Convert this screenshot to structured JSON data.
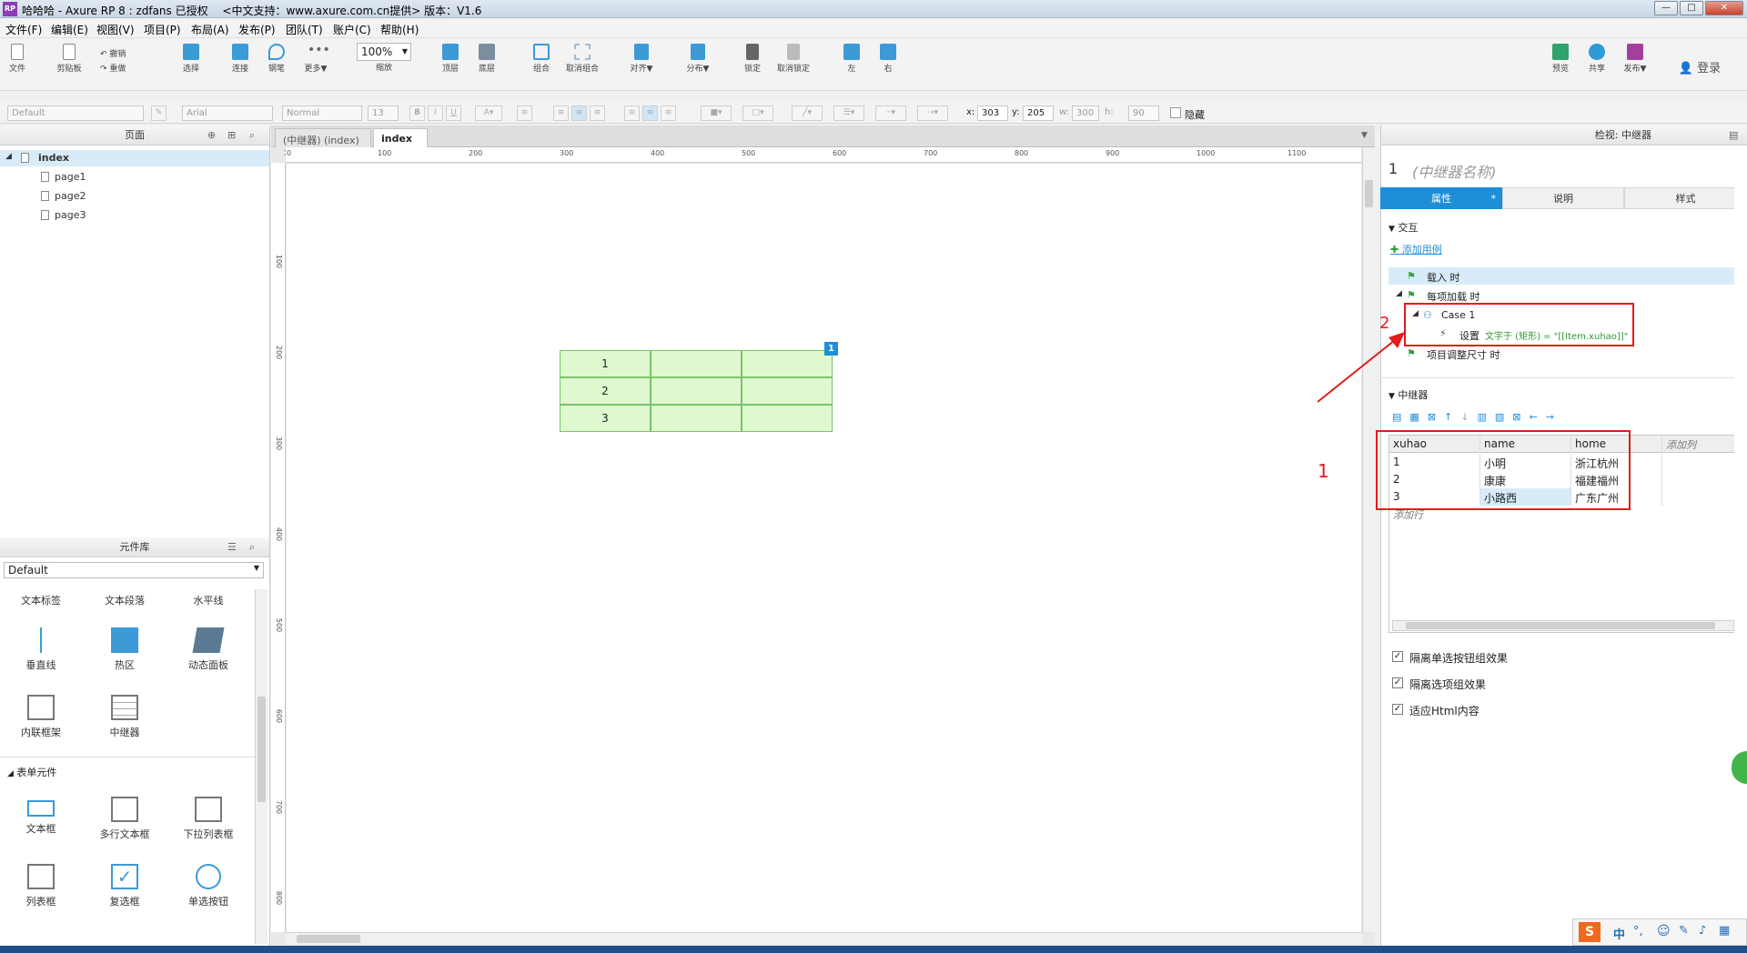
{
  "window": {
    "title": "哈哈哈 - Axure RP 8 : zdfans 已授权　 <中文支持：www.axure.com.cn提供> 版本：V1.6",
    "logo": "RP",
    "min": "—",
    "max": "□",
    "close": "✕"
  },
  "menu": [
    "文件(F)",
    "编辑(E)",
    "视图(V)",
    "项目(P)",
    "布局(A)",
    "发布(P)",
    "团队(T)",
    "账户(C)",
    "帮助(H)"
  ],
  "toolbar": {
    "file": "文件",
    "clipboard": "剪贴板",
    "undo": "撤销",
    "redo": "重做",
    "select": "选择",
    "connect": "连接",
    "pen": "钢笔",
    "more": "更多▼",
    "zoom_value": "100%",
    "zoom_label": "缩放",
    "top": "顶层",
    "bottom": "底层",
    "group": "组合",
    "ungroup": "取消组合",
    "align": "对齐▼",
    "distribute": "分布▼",
    "lock": "锁定",
    "unlock": "取消锁定",
    "left": "左",
    "right": "右",
    "preview": "预览",
    "share": "共享",
    "publish": "发布▼",
    "login": "登录"
  },
  "propbar": {
    "style": "Default",
    "font": "Arial",
    "weight": "Normal",
    "size": "13",
    "x_label": "x:",
    "x": "303",
    "y_label": "y:",
    "y": "205",
    "w_label": "w:",
    "w": "300",
    "h_label": "h:",
    "h": "90",
    "hide": "隐藏"
  },
  "pages": {
    "header": "页面",
    "items": [
      "index",
      "page1",
      "page2",
      "page3"
    ]
  },
  "library": {
    "header": "元件库",
    "selected": "Default",
    "row1": [
      "文本标签",
      "文本段落",
      "水平线"
    ],
    "row2": [
      "垂直线",
      "热区",
      "动态面板"
    ],
    "row3": [
      "内联框架",
      "中继器"
    ],
    "section": "表单元件",
    "row4": [
      "文本框",
      "多行文本框",
      "下拉列表框"
    ],
    "row5": [
      "列表框",
      "复选框",
      "单选按钮"
    ]
  },
  "tabs": [
    "(中继器) (index)",
    "index"
  ],
  "ruler_h": [
    "0",
    "100",
    "200",
    "300",
    "400",
    "500",
    "600",
    "700",
    "800",
    "900",
    "1000",
    "1100"
  ],
  "ruler_v": [
    "100",
    "200",
    "300",
    "400",
    "500",
    "600",
    "700",
    "800"
  ],
  "canvas": {
    "cells": [
      "1",
      "2",
      "3"
    ],
    "badge": "1"
  },
  "inspector": {
    "header": "检视: 中继器",
    "index": "1",
    "name_placeholder": "(中继器名称)",
    "tabs": [
      "属性",
      "说明",
      "样式"
    ],
    "tab_mark": "*",
    "interaction": "交互",
    "add_case": "添加用例",
    "on_load": "载入 时",
    "on_item_load": "每项加载 时",
    "case": "Case 1",
    "action_prefix": "设置",
    "action_body": "文字于 (矩形) = \"[[Item.xuhao]]\"",
    "on_resize": "项目调整尺寸 时",
    "repeater": "中继器",
    "columns": [
      "xuhao",
      "name",
      "home"
    ],
    "add_col": "添加列",
    "rows": [
      [
        "1",
        "小明",
        "浙江杭州"
      ],
      [
        "2",
        "康康",
        "福建福州"
      ],
      [
        "3",
        "小路西",
        "广东广州"
      ]
    ],
    "add_row": "添加行",
    "options": [
      "隔离单选按钮组效果",
      "隔离选项组效果",
      "适应Html内容"
    ]
  },
  "annotations": {
    "one": "1",
    "two": "2"
  },
  "ime": [
    "S",
    "中",
    "°,",
    "☺"
  ]
}
